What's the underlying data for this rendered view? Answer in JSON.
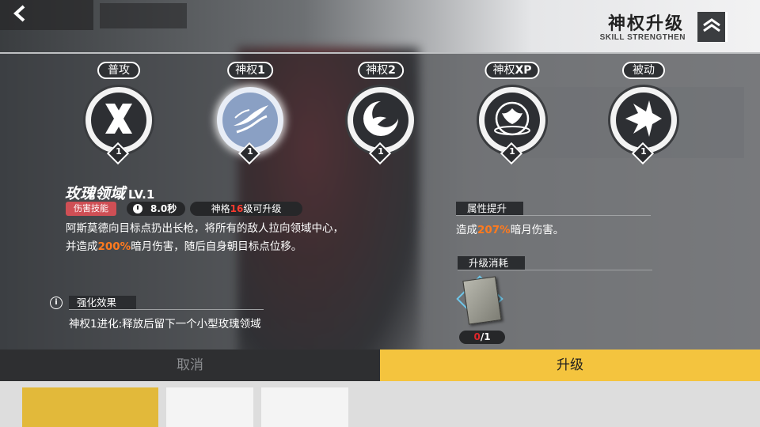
{
  "header": {
    "title": "神权升级",
    "subtitle": "SKILL STRENGTHEN"
  },
  "skills": [
    {
      "name_prefix": "普攻",
      "name_suffix": "",
      "level": "1",
      "icon": "cross-blades-icon",
      "active": false
    },
    {
      "name_prefix": "神权",
      "name_suffix": "1",
      "level": "1",
      "icon": "spear-swirl-icon",
      "active": true
    },
    {
      "name_prefix": "神权",
      "name_suffix": "2",
      "level": "1",
      "icon": "crescent-moon-icon",
      "active": false
    },
    {
      "name_prefix": "神权",
      "name_suffix": "XP",
      "level": "1",
      "icon": "phoenix-emblem-icon",
      "active": false
    },
    {
      "name_prefix": "被动",
      "name_suffix": "",
      "level": "1",
      "icon": "burst-arrow-icon",
      "active": false
    }
  ],
  "detail": {
    "skill_name": "玫瑰领域",
    "skill_level": "LV.1",
    "type_tag": "伤害技能",
    "cooldown": "8.0秒",
    "requirement_prefix": "神格",
    "requirement_level": "16",
    "requirement_suffix": "级可升级",
    "desc_line1": "阿斯莫德向目标点扔出长枪，将所有的敌人拉向领域中心，",
    "desc_line2_prefix": "并造成",
    "desc_line2_highlight": "200%",
    "desc_line2_suffix": "暗月伤害，随后自身朝目标点位移。",
    "enhance_title": "强化效果",
    "enhance_text": "神权1进化:释放后留下一个小型玫瑰领域"
  },
  "attribute": {
    "title": "属性提升",
    "text_prefix": "造成",
    "text_highlight": "207%",
    "text_suffix": "暗月伤害。"
  },
  "cost": {
    "title": "升级消耗",
    "have": "0",
    "need": "/1"
  },
  "buttons": {
    "cancel": "取消",
    "upgrade": "升级"
  },
  "colors": {
    "accent_yellow": "#f4c43e",
    "highlight_orange": "#ff7a1e",
    "tag_red": "#cf4f55",
    "count_red": "#e0262b"
  }
}
